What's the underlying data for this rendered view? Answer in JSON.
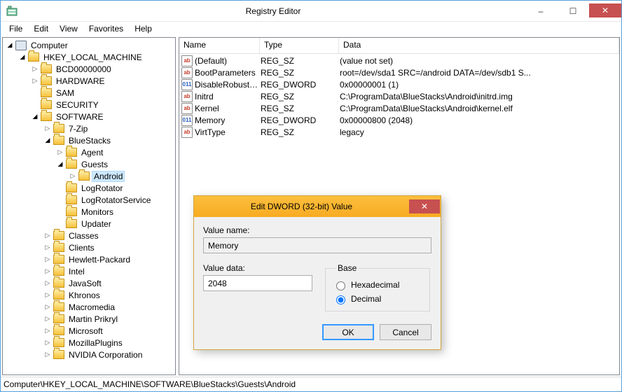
{
  "window": {
    "title": "Registry Editor",
    "minimize": "–",
    "maximize": "☐",
    "close": "✕"
  },
  "menu": {
    "file": "File",
    "edit": "Edit",
    "view": "View",
    "favorites": "Favorites",
    "help": "Help"
  },
  "tree": {
    "root": "Computer",
    "hklm": "HKEY_LOCAL_MACHINE",
    "bcd": "BCD00000000",
    "hardware": "HARDWARE",
    "sam": "SAM",
    "security": "SECURITY",
    "software": "SOFTWARE",
    "sevenzip": "7-Zip",
    "bluestacks": "BlueStacks",
    "agent": "Agent",
    "guests": "Guests",
    "android": "Android",
    "logrotator": "LogRotator",
    "logrotatorservice": "LogRotatorService",
    "monitors": "Monitors",
    "updater": "Updater",
    "classes": "Classes",
    "clients": "Clients",
    "hp": "Hewlett-Packard",
    "intel": "Intel",
    "javasoft": "JavaSoft",
    "khronos": "Khronos",
    "macromedia": "Macromedia",
    "martin": "Martin Prikryl",
    "microsoft": "Microsoft",
    "mozilla": "MozillaPlugins",
    "nvidia": "NVIDIA Corporation"
  },
  "list": {
    "headers": {
      "name": "Name",
      "type": "Type",
      "data": "Data"
    },
    "rows": [
      {
        "icon": "sz",
        "iconText": "ab",
        "name": "(Default)",
        "type": "REG_SZ",
        "data": "(value not set)"
      },
      {
        "icon": "sz",
        "iconText": "ab",
        "name": "BootParameters",
        "type": "REG_SZ",
        "data": "root=/dev/sda1 SRC=/android DATA=/dev/sdb1 S..."
      },
      {
        "icon": "dw",
        "iconText": "011",
        "name": "DisableRobustn...",
        "type": "REG_DWORD",
        "data": "0x00000001 (1)"
      },
      {
        "icon": "sz",
        "iconText": "ab",
        "name": "Initrd",
        "type": "REG_SZ",
        "data": "C:\\ProgramData\\BlueStacks\\Android\\initrd.img"
      },
      {
        "icon": "sz",
        "iconText": "ab",
        "name": "Kernel",
        "type": "REG_SZ",
        "data": "C:\\ProgramData\\BlueStacks\\Android\\kernel.elf"
      },
      {
        "icon": "dw",
        "iconText": "011",
        "name": "Memory",
        "type": "REG_DWORD",
        "data": "0x00000800 (2048)"
      },
      {
        "icon": "sz",
        "iconText": "ab",
        "name": "VirtType",
        "type": "REG_SZ",
        "data": "legacy"
      }
    ]
  },
  "dialog": {
    "title": "Edit DWORD (32-bit) Value",
    "close": "✕",
    "name_label": "Value name:",
    "name_value": "Memory",
    "data_label": "Value data:",
    "data_value": "2048",
    "base_label": "Base",
    "hex": "Hexadecimal",
    "dec": "Decimal",
    "ok": "OK",
    "cancel": "Cancel"
  },
  "statusbar": "Computer\\HKEY_LOCAL_MACHINE\\SOFTWARE\\BlueStacks\\Guests\\Android"
}
